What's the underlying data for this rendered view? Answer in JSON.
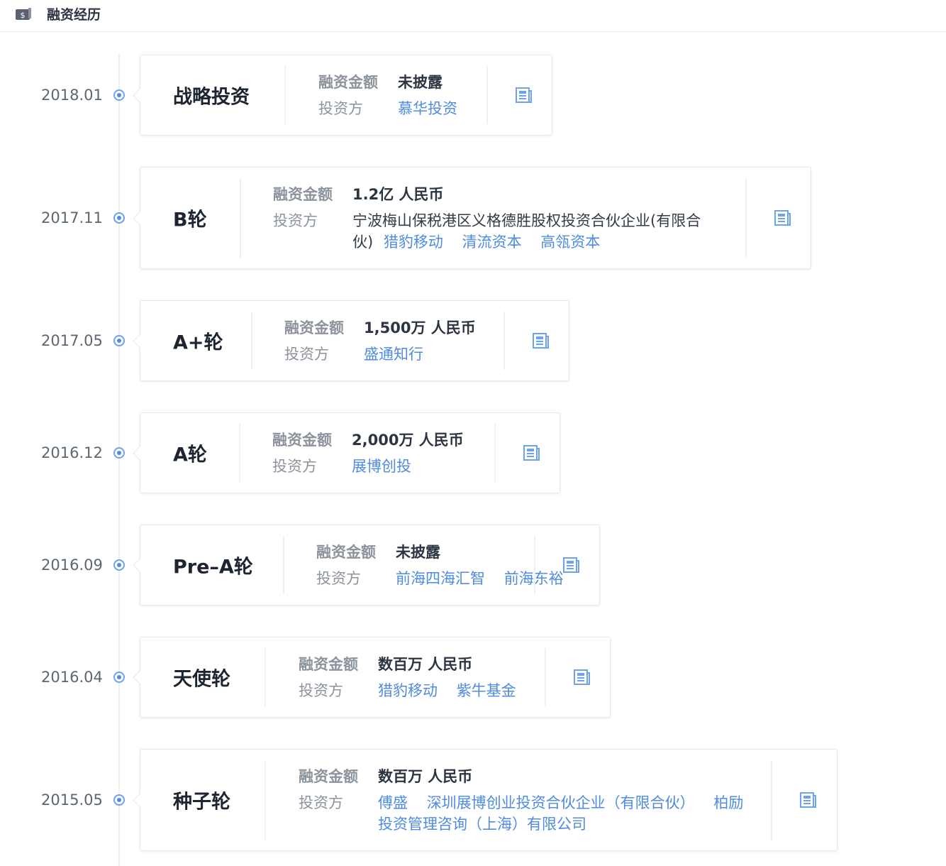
{
  "header": {
    "title": "融资经历",
    "icon": "dollar-wallet-icon"
  },
  "labels": {
    "amount": "融资金额",
    "investors": "投资方"
  },
  "colors": {
    "link": "#4f8be0",
    "accent": "#6ea2e9"
  },
  "rounds": [
    {
      "date": "2018.01",
      "name": "战略投资",
      "amount": "未披露",
      "investors": [
        {
          "text": "慕华投资",
          "link": true
        }
      ]
    },
    {
      "date": "2017.11",
      "name": "B轮",
      "amount": "1.2亿 人民币",
      "investors": [
        {
          "text": "宁波梅山保税港区义格德胜股权投资合伙企业(有限合伙)",
          "link": false
        },
        {
          "text": "猎豹移动",
          "link": true
        },
        {
          "text": "清流资本",
          "link": true
        },
        {
          "text": "高瓴资本",
          "link": true
        }
      ]
    },
    {
      "date": "2017.05",
      "name": "A+轮",
      "amount": "1,500万 人民币",
      "investors": [
        {
          "text": "盛通知行",
          "link": true
        }
      ]
    },
    {
      "date": "2016.12",
      "name": "A轮",
      "amount": "2,000万 人民币",
      "investors": [
        {
          "text": "展博创投",
          "link": true
        }
      ]
    },
    {
      "date": "2016.09",
      "name": "Pre–A轮",
      "amount": "未披露",
      "investors": [
        {
          "text": "前海四海汇智",
          "link": true
        },
        {
          "text": "前海东裕",
          "link": true
        }
      ]
    },
    {
      "date": "2016.04",
      "name": "天使轮",
      "amount": "数百万 人民币",
      "investors": [
        {
          "text": "猎豹移动",
          "link": true
        },
        {
          "text": "紫牛基金",
          "link": true
        }
      ]
    },
    {
      "date": "2015.05",
      "name": "种子轮",
      "amount": "数百万 人民币",
      "investors": [
        {
          "text": "傅盛",
          "link": true
        },
        {
          "text": "深圳展博创业投资合伙企业（有限合伙）",
          "link": true
        },
        {
          "text": "柏励投资管理咨询（上海）有限公司",
          "link": true
        }
      ]
    }
  ]
}
